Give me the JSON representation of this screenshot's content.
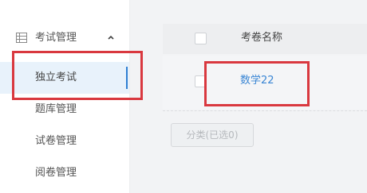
{
  "sidebar": {
    "group": {
      "label": "考试管理",
      "icon": "grid-icon",
      "expanded_icon": "chevron-up-icon"
    },
    "items": [
      {
        "label": "独立考试",
        "active": true
      },
      {
        "label": "题库管理",
        "active": false
      },
      {
        "label": "试卷管理",
        "active": false
      },
      {
        "label": "阅卷管理",
        "active": false
      }
    ]
  },
  "table": {
    "header": {
      "column_title": "考卷名称"
    },
    "rows": [
      {
        "name": "数学22"
      }
    ]
  },
  "actions": {
    "category_button_label": "分类(已选0)"
  },
  "colors": {
    "accent": "#2f7fd2",
    "link": "#3a86d4",
    "highlight_border": "#d9383f",
    "active_bg": "#e8f2fb"
  }
}
